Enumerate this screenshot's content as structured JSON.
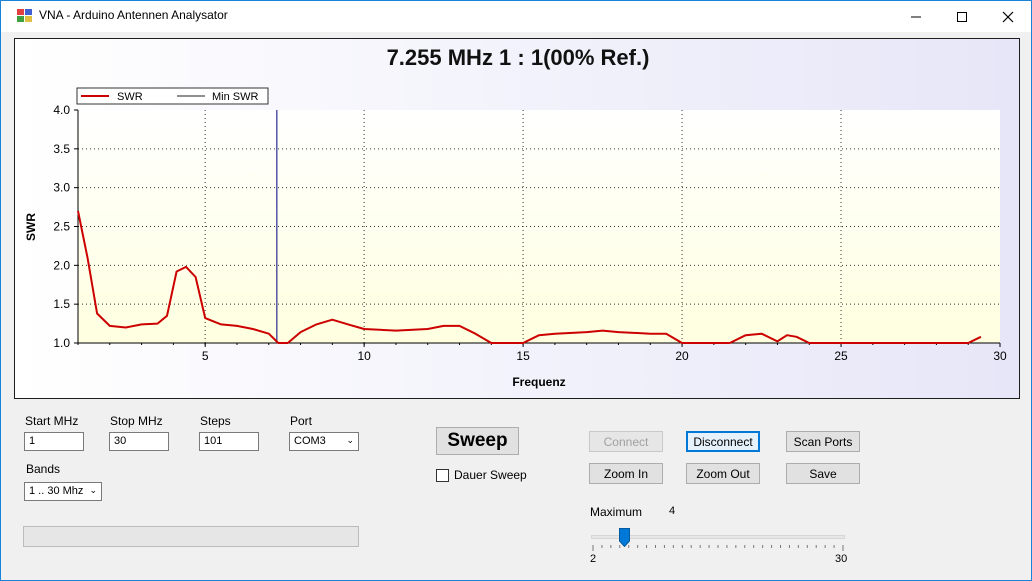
{
  "window": {
    "title": "VNA - Arduino Antennen Analysator",
    "minimize": "—",
    "maximize": "☐",
    "close": "✕"
  },
  "chart_header": "7.255 MHz   1 : 1(00% Ref.)",
  "legend": {
    "swr": "SWR",
    "min_swr": "Min SWR"
  },
  "colors": {
    "swr_line": "#cc0000",
    "marker": "#000080",
    "plot_bg_top": "#ffffff",
    "plot_bg_bottom": "#ffffe0"
  },
  "chart_data": {
    "type": "line",
    "xlabel": "Frequenz",
    "ylabel": "SWR",
    "xlim": [
      1,
      30
    ],
    "ylim": [
      1.0,
      4.0
    ],
    "xticks": [
      "5",
      "10",
      "15",
      "20",
      "25",
      "30"
    ],
    "yticks": [
      "1.0",
      "1.5",
      "2.0",
      "2.5",
      "3.0",
      "3.5",
      "4.0"
    ],
    "marker_x": 7.255,
    "grid": true,
    "series": [
      {
        "name": "SWR",
        "x": [
          1.0,
          1.3,
          1.6,
          2.0,
          2.5,
          3.0,
          3.5,
          3.8,
          4.1,
          4.4,
          4.7,
          5.0,
          5.5,
          6.0,
          6.5,
          7.0,
          7.3,
          7.6,
          8.0,
          8.5,
          9.0,
          9.5,
          10.0,
          11.0,
          12.0,
          12.5,
          13.0,
          13.5,
          14.0,
          15.0,
          15.5,
          16.0,
          17.0,
          17.5,
          18.0,
          19.0,
          19.5,
          20.0,
          21.0,
          21.5,
          22.0,
          22.5,
          23.0,
          23.3,
          23.6,
          24.0,
          25.0,
          26.0,
          27.0,
          28.0,
          29.0,
          29.4
        ],
        "values": [
          2.7,
          2.1,
          1.38,
          1.22,
          1.2,
          1.24,
          1.25,
          1.35,
          1.92,
          1.98,
          1.85,
          1.32,
          1.24,
          1.22,
          1.18,
          1.12,
          1.0,
          1.0,
          1.14,
          1.24,
          1.3,
          1.24,
          1.18,
          1.16,
          1.18,
          1.22,
          1.22,
          1.12,
          1.0,
          1.0,
          1.1,
          1.12,
          1.14,
          1.16,
          1.14,
          1.12,
          1.12,
          1.0,
          1.0,
          1.0,
          1.1,
          1.12,
          1.02,
          1.1,
          1.08,
          1.0,
          1.0,
          1.0,
          1.0,
          1.0,
          1.0,
          1.08
        ]
      }
    ]
  },
  "controls": {
    "start_label": "Start MHz",
    "start_value": "1",
    "stop_label": "Stop MHz",
    "stop_value": "30",
    "steps_label": "Steps",
    "steps_value": "101",
    "port_label": "Port",
    "port_value": "COM3",
    "bands_label": "Bands",
    "bands_value": "1 .. 30 Mhz",
    "sweep": "Sweep",
    "dauer_sweep": "Dauer Sweep",
    "connect": "Connect",
    "disconnect": "Disconnect",
    "scan_ports": "Scan Ports",
    "zoom_in": "Zoom In",
    "zoom_out": "Zoom Out",
    "save": "Save",
    "maximum_label": "Maximum",
    "maximum_value": "4",
    "slider_min": "2",
    "slider_max": "30",
    "slider_level": 4
  }
}
